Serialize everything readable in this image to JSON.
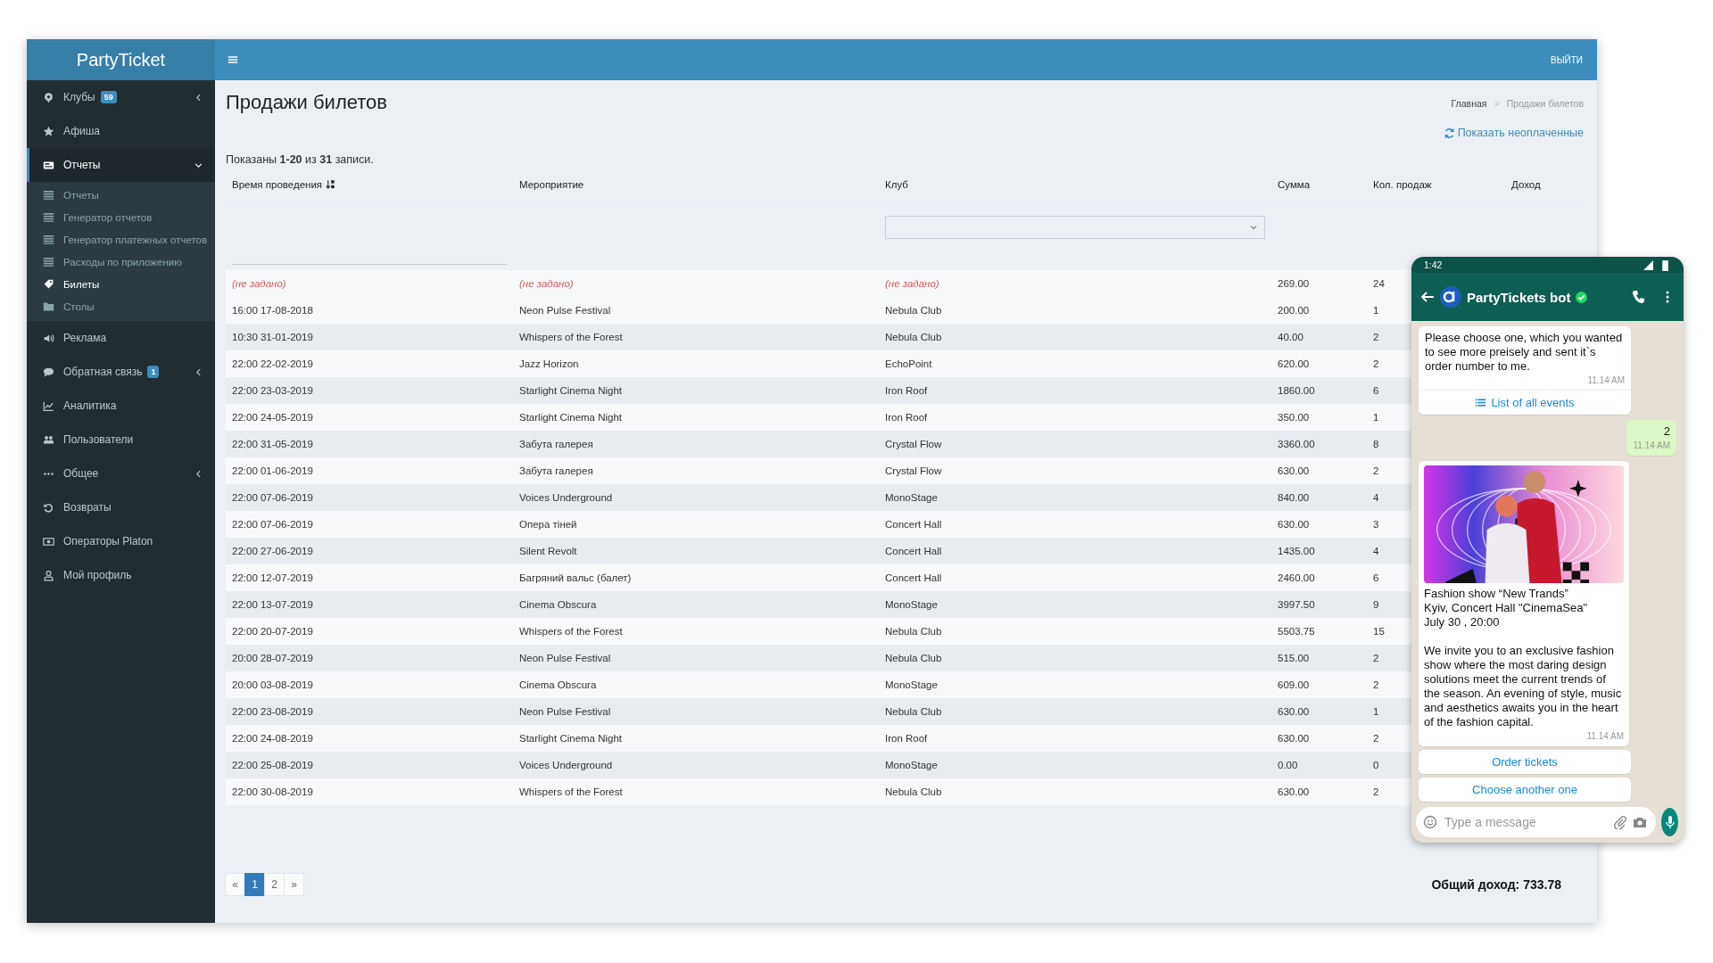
{
  "brand": "PartyTicket",
  "topbar": {
    "logout": "ВЫЙТИ"
  },
  "sidebar": {
    "items": [
      {
        "label": "Клубы",
        "badge": "59",
        "has_submenu": true,
        "expanded": false,
        "selected": false
      },
      {
        "label": "Афиша",
        "has_submenu": false,
        "selected": false
      },
      {
        "label": "Отчеты",
        "has_submenu": true,
        "expanded": true,
        "selected": true,
        "children": [
          {
            "label": "Отчеты",
            "selected": false
          },
          {
            "label": "Генератор отчетов",
            "selected": false
          },
          {
            "label": "Генератор платежных отчетов",
            "selected": false
          },
          {
            "label": "Расходы по приложению",
            "selected": false
          },
          {
            "label": "Билеты",
            "selected": true
          },
          {
            "label": "Столы",
            "selected": false
          }
        ]
      },
      {
        "label": "Реклама",
        "has_submenu": false,
        "selected": false
      },
      {
        "label": "Обратная связь",
        "badge": "1",
        "has_submenu": true,
        "expanded": false,
        "selected": false
      },
      {
        "label": "Аналитика",
        "has_submenu": false,
        "selected": false
      },
      {
        "label": "Пользователи",
        "has_submenu": false,
        "selected": false
      },
      {
        "label": "Общее",
        "has_submenu": true,
        "expanded": false,
        "selected": false
      },
      {
        "label": "Возвраты",
        "has_submenu": false,
        "selected": false
      },
      {
        "label": "Операторы Platon",
        "has_submenu": false,
        "selected": false
      },
      {
        "label": "Мой профиль",
        "has_submenu": false,
        "selected": false
      }
    ]
  },
  "page": {
    "title": "Продажи билетов",
    "breadcrumb": [
      "Главная",
      "Продажи билетов"
    ],
    "breadcrumb_separator": ">",
    "action_link": "Показать неоплаченные",
    "summary": "Показаны **1-20** из **31** записи."
  },
  "table": {
    "columns": [
      {
        "label": "Время проведения",
        "sorted": true,
        "filter": {
          "kind": "text"
        }
      },
      {
        "label": "Мероприятие",
        "sorted": false
      },
      {
        "label": "Клуб",
        "sorted": false,
        "filter": {
          "kind": "select"
        }
      },
      {
        "label": "Сумма",
        "sorted": false
      },
      {
        "label": "Кол. продаж",
        "sorted": false
      },
      {
        "label": "Доход",
        "sorted": false
      }
    ],
    "rows": [
      {
        "unset": true,
        "cells": [
          "(не задано)",
          "(не задано)",
          "(не задано)",
          "269.00",
          "24"
        ]
      },
      {
        "unset": false,
        "cells": [
          "16:00 17-08-2018",
          "Neon Pulse Festival",
          "Nebula Club",
          "200.00",
          "1"
        ]
      },
      {
        "unset": false,
        "cells": [
          "10:30 31-01-2019",
          "Whispers of the Forest",
          "Nebula Club",
          "40.00",
          "2"
        ]
      },
      {
        "unset": false,
        "cells": [
          "22:00 22-02-2019",
          "Jazz Horizon",
          "EchoPoint",
          "620.00",
          "2"
        ]
      },
      {
        "unset": false,
        "cells": [
          "22:00 23-03-2019",
          "Starlight Cinema Night",
          "Iron Roof",
          "1860.00",
          "6"
        ]
      },
      {
        "unset": false,
        "cells": [
          "22:00 24-05-2019",
          "Starlight Cinema Night",
          "Iron Roof",
          "350.00",
          "1"
        ]
      },
      {
        "unset": false,
        "cells": [
          "22:00 31-05-2019",
          "Забута галерея",
          "Crystal Flow",
          "3360.00",
          "8"
        ]
      },
      {
        "unset": false,
        "cells": [
          "22:00 01-06-2019",
          "Забута галерея",
          "Crystal Flow",
          "630.00",
          "2"
        ]
      },
      {
        "unset": false,
        "cells": [
          "22:00 07-06-2019",
          "Voices Underground",
          "MonoStage",
          "840.00",
          "4"
        ]
      },
      {
        "unset": false,
        "cells": [
          "22:00 07-06-2019",
          "Опера тіней",
          "Concert Hall",
          "630.00",
          "3"
        ]
      },
      {
        "unset": false,
        "cells": [
          "22:00 27-06-2019",
          "Silent Revolt",
          "Concert Hall",
          "1435.00",
          "4"
        ]
      },
      {
        "unset": false,
        "cells": [
          "22:00 12-07-2019",
          "Багряний вальс (балет)",
          "Concert Hall",
          "2460.00",
          "6"
        ]
      },
      {
        "unset": false,
        "cells": [
          "22:00 13-07-2019",
          "Cinema Obscura",
          "MonoStage",
          "3997.50",
          "9"
        ]
      },
      {
        "unset": false,
        "cells": [
          "22:00 20-07-2019",
          "Whispers of the Forest",
          "Nebula Club",
          "5503.75",
          "15"
        ]
      },
      {
        "unset": false,
        "cells": [
          "20:00 28-07-2019",
          "Neon Pulse Festival",
          "Nebula Club",
          "515.00",
          "2"
        ]
      },
      {
        "unset": false,
        "cells": [
          "20:00 03-08-2019",
          "Cinema Obscura",
          "MonoStage",
          "609.00",
          "2"
        ]
      },
      {
        "unset": false,
        "cells": [
          "22:00 23-08-2019",
          "Neon Pulse Festival",
          "Nebula Club",
          "630.00",
          "1"
        ]
      },
      {
        "unset": false,
        "cells": [
          "22:00 24-08-2019",
          "Starlight Cinema Night",
          "Iron Roof",
          "630.00",
          "2"
        ]
      },
      {
        "unset": false,
        "cells": [
          "22:00 25-08-2019",
          "Voices Underground",
          "MonoStage",
          "0.00",
          "0"
        ]
      },
      {
        "unset": false,
        "cells": [
          "22:00 30-08-2019",
          "Whispers of the Forest",
          "Nebula Club",
          "630.00",
          "2"
        ]
      }
    ]
  },
  "pagination": [
    {
      "label": "«",
      "selected": false
    },
    {
      "label": "1",
      "selected": true
    },
    {
      "label": "2",
      "selected": false
    },
    {
      "label": "»",
      "selected": false
    }
  ],
  "total": "Общий доход: 733.78",
  "chat": {
    "time": "1:42",
    "bot_name": "PartyTickets bot",
    "messages": [
      {
        "kind": "incoming",
        "text": "Please choose one, which you wanted to see more preisely and sent it`s order number to me.",
        "time": "11.14 AM",
        "action": "List of all events"
      },
      {
        "kind": "outgoing",
        "text": "2",
        "time": "11.14 AM"
      },
      {
        "kind": "card",
        "picture": {
          "kind": "picture"
        },
        "lines": [
          "Fashion show “New Trands”",
          "Kyiv, Concert Hall \"CinemaSea\"",
          "July 30 , 20:00"
        ],
        "body": "We invite you to an exclusive fashion show where the most daring design solutions meet the current trends of the season. An evening of style, music and aesthetics awaits you in the heart of the fashion capital.",
        "time": "11.14 AM"
      }
    ],
    "quick_replies": [
      "Order tickets",
      "Choose another one"
    ],
    "input": {
      "placeholder": "Type a message"
    }
  }
}
